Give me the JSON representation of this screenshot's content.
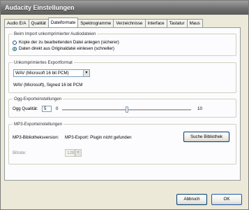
{
  "window": {
    "title": "Audacity Einstellungen"
  },
  "tabs": [
    {
      "label": "Audio E/A"
    },
    {
      "label": "Qualität"
    },
    {
      "label": "Dateiformate"
    },
    {
      "label": "Spektrogramme"
    },
    {
      "label": "Verzeichnisse"
    },
    {
      "label": "Interface"
    },
    {
      "label": "Tastatur"
    },
    {
      "label": "Maus"
    }
  ],
  "active_tab": "Dateiformate",
  "import": {
    "title": "Beim Import unkomprimierter Audiodateien",
    "option_copy": "Kopie der zu bearbeitenden Datei anlegen (sicherer)",
    "option_direct": "Daten direkt aus Originaldatei einlesen (schneller)",
    "selected": "direct"
  },
  "export": {
    "title": "Unkomprimiertes Exportformat",
    "format_value": "WAV (Microsoft 16 bit PCM)",
    "format_desc": "WAV (Microsoft), Signed 16 bit PCM"
  },
  "ogg": {
    "title": "Ogg-Exporteinstellungen",
    "quality_label": "Ogg Qualität:",
    "quality_value": "5",
    "min_label": "0",
    "max_label": "10",
    "slider_fraction": 0.5
  },
  "mp3": {
    "title": "MP3-Exporteinstellungen",
    "library_label": "MP3-Bibliotheksversion:",
    "library_status": "MP3-Export: Plugin nicht gefunden",
    "find_button": "Suche Bibliothek",
    "bitrate_label": "Bitrate:",
    "bitrate_value": "128"
  },
  "footer": {
    "cancel_button": "Abbruch",
    "ok_button": "OK"
  }
}
